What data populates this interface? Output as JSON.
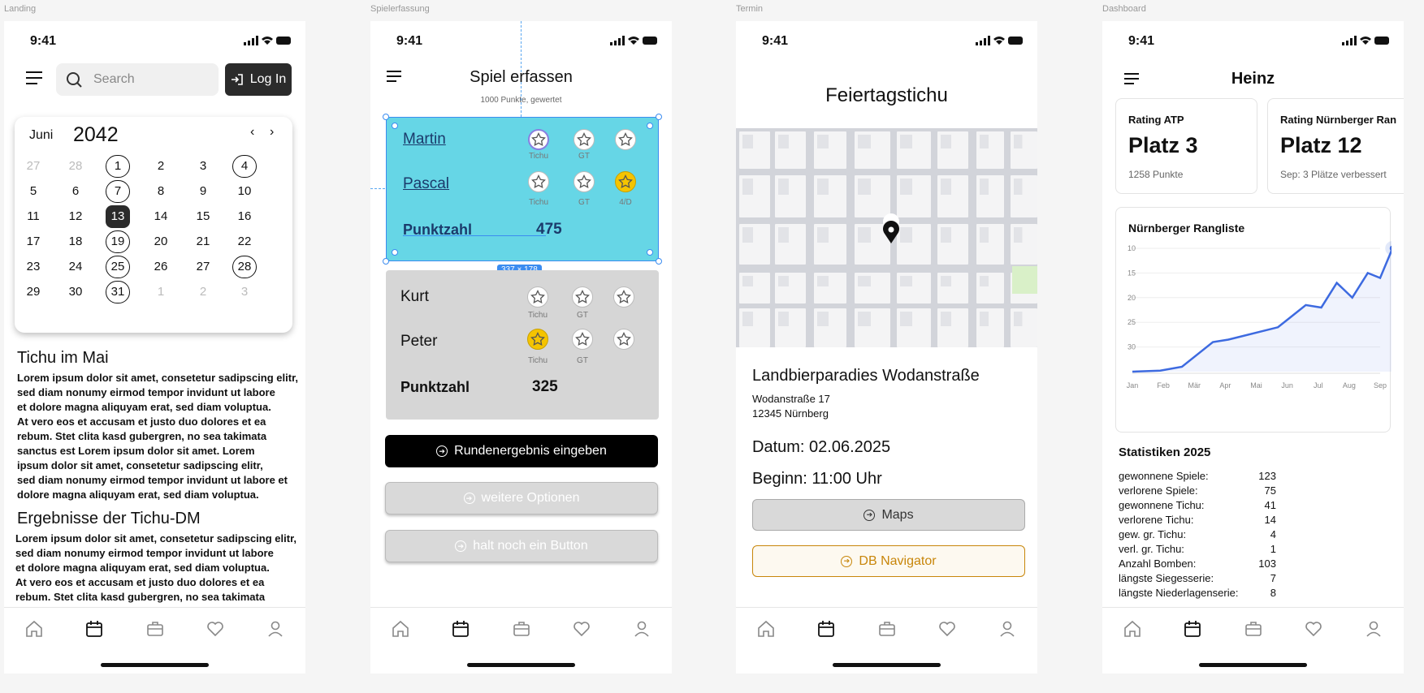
{
  "frames": {
    "landing": "Landing",
    "spiel": "Spielerfassung",
    "termin": "Termin",
    "dashboard": "Dashboard"
  },
  "status": {
    "time": "9:41"
  },
  "landing": {
    "search_placeholder": "Search",
    "login": "Log In",
    "month": "Juni",
    "year": "2042",
    "days": [
      [
        "27",
        "28",
        "1",
        "2",
        "3",
        "4"
      ],
      [
        "5",
        "6",
        "7",
        "8",
        "9",
        "10"
      ],
      [
        "11",
        "12",
        "13",
        "14",
        "15",
        "16"
      ],
      [
        "17",
        "18",
        "19",
        "20",
        "21",
        "22"
      ],
      [
        "23",
        "24",
        "25",
        "26",
        "27",
        "28"
      ],
      [
        "29",
        "30",
        "31",
        "1",
        "2",
        "3"
      ]
    ],
    "h1": "Tichu im Mai",
    "p1": "Lorem ipsum dolor sit amet, consetetur sadipscing elitr,\nsed diam nonumy eirmod tempor invidunt ut labore\net dolore magna aliquyam erat, sed diam voluptua.\nAt vero eos et accusam et justo duo dolores et ea\nrebum. Stet clita kasd gubergren, no sea takimata\nsanctus est Lorem ipsum dolor sit amet. Lorem\nipsum dolor sit amet, consetetur sadipscing elitr,\nsed diam nonumy eirmod tempor invidunt ut labore et\ndolore magna aliquyam erat, sed diam voluptua.",
    "h2": "Ergebnisse der Tichu-DM",
    "p2": "Lorem ipsum dolor sit amet, consetetur sadipscing elitr,\nsed diam nonumy eirmod tempor invidunt ut labore\net dolore magna aliquyam erat, sed diam voluptua.\nAt vero eos et accusam et justo duo dolores et ea\nrebum. Stet clita kasd gubergren, no sea takimata"
  },
  "spiel": {
    "title": "Spiel erfassen",
    "subtitle": "1000 Punkte, gewertet",
    "team1": {
      "p1": "Martin",
      "p2": "Pascal",
      "score_label": "Punktzahl",
      "score": "475"
    },
    "team2": {
      "p1": "Kurt",
      "p2": "Peter",
      "score_label": "Punktzahl",
      "score": "325"
    },
    "lbl_tichu": "Tichu",
    "lbl_gt": "GT",
    "lbl_4d": "4/D",
    "sel_size": "337 × 178",
    "btn1": "Rundenergebnis eingeben",
    "btn2": "weitere Optionen",
    "btn3": "halt noch ein Button"
  },
  "termin": {
    "title": "Feiertagstichu",
    "venue": "Landbierparadies Wodanstraße",
    "street": "Wodanstraße 17",
    "city": "12345 Nürnberg",
    "date": "Datum: 02.06.2025",
    "begin": "Beginn: 11:00 Uhr",
    "btn_maps": "Maps",
    "btn_db": "DB Navigator"
  },
  "dashboard": {
    "name": "Heinz",
    "card1": {
      "label": "Rating ATP",
      "value": "Platz 3",
      "sub": "1258 Punkte"
    },
    "card2": {
      "label": "Rating Nürnberger Ran",
      "value": "Platz 12",
      "sub": "Sep: 3 Plätze verbessert"
    },
    "chart_title": "Nürnberger Rangliste",
    "stats_title": "Statistiken 2025",
    "stats": [
      {
        "k": "gewonnene Spiele:",
        "v": "123"
      },
      {
        "k": "verlorene Spiele:",
        "v": "75"
      },
      {
        "k": "gewonnene Tichu:",
        "v": "41"
      },
      {
        "k": "verlorene Tichu:",
        "v": "14"
      },
      {
        "k": "gew. gr. Tichu:",
        "v": "4"
      },
      {
        "k": "verl. gr. Tichu:",
        "v": "1"
      },
      {
        "k": "Anzahl Bomben:",
        "v": "103"
      },
      {
        "k": "längste Siegesserie:",
        "v": "7"
      },
      {
        "k": "längste Niederlagenserie:",
        "v": "8"
      }
    ]
  },
  "chart_data": {
    "type": "line",
    "title": "Nürnberger Rangliste",
    "categories": [
      "Jan",
      "Feb",
      "Mär",
      "Apr",
      "Mai",
      "Jun",
      "Jul",
      "Aug",
      "Sep"
    ],
    "x": [
      0,
      0.9,
      1.6,
      2.6,
      3.1,
      4.7,
      5.1,
      5.6,
      6.1,
      6.6,
      7.1,
      7.6,
      8.0,
      8.4,
      8.8,
      9.3
    ],
    "y": [
      35,
      34.8,
      34,
      29,
      28.5,
      26,
      24,
      21.5,
      22,
      17,
      20,
      15,
      16,
      10
    ],
    "yticks": [
      10,
      15,
      20,
      25,
      30
    ],
    "ylim": [
      10,
      35
    ],
    "y_inverted": true,
    "grid": true,
    "color": "#3d6ae0"
  },
  "colors": {
    "accent_cyan": "#66d6e6",
    "selection": "#3b8cf0",
    "gold": "#f5c400",
    "db_orange": "#c8860a"
  }
}
